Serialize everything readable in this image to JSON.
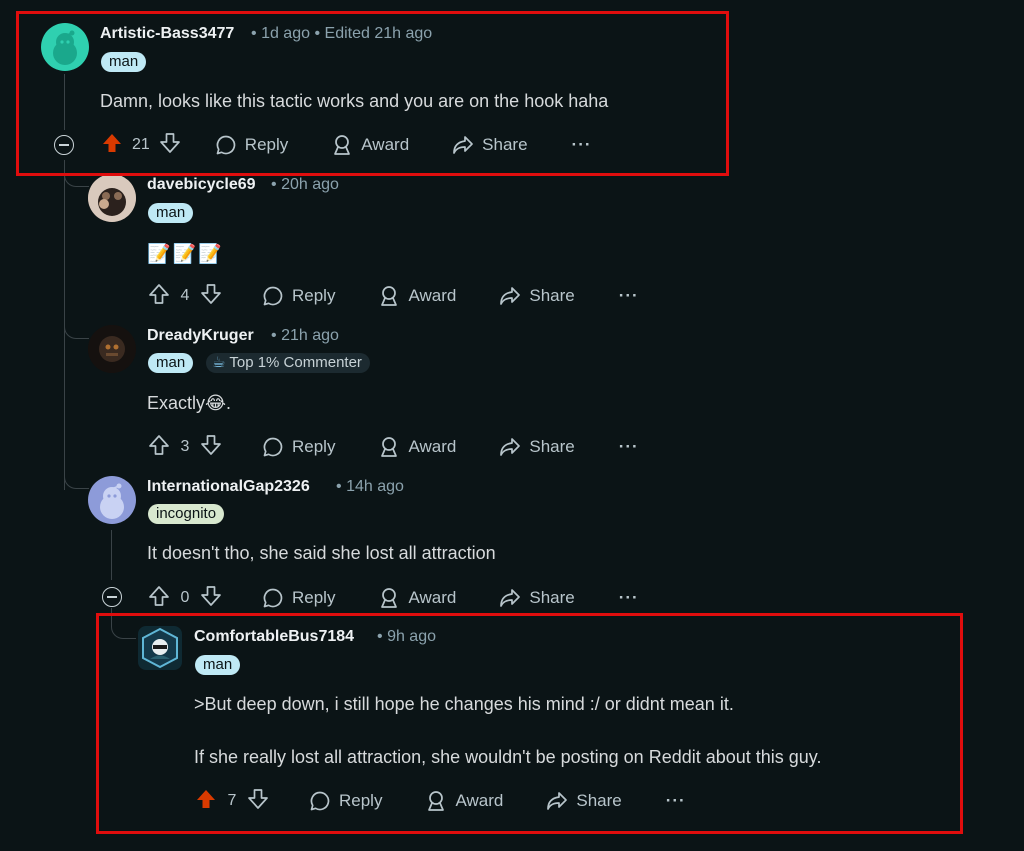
{
  "comments": [
    {
      "username": "Artistic-Bass3477",
      "time": "1d ago",
      "edited": "Edited 21h ago",
      "flair": "man",
      "body": "Damn, looks like this tactic works and you are on the hook haha",
      "votes": "21",
      "upvoted": true
    },
    {
      "username": "davebicycle69",
      "time": "20h ago",
      "flair": "man",
      "body": "📝📝📝",
      "votes": "4",
      "upvoted": false
    },
    {
      "username": "DreadyKruger",
      "time": "21h ago",
      "flair": "man",
      "badge": "Top 1% Commenter",
      "body": "Exactly😂.",
      "votes": "3",
      "upvoted": false
    },
    {
      "username": "InternationalGap2326",
      "time": "14h ago",
      "flair": "incognito",
      "body": "It doesn't tho, she said she lost all attraction",
      "votes": "0",
      "upvoted": false
    },
    {
      "username": "ComfortableBus7184",
      "time": "9h ago",
      "flair": "man",
      "body1": ">But deep down, i still hope he changes his mind :/ or didnt mean it.",
      "body2": "If she really lost all attraction, she wouldn't be posting on Reddit about this guy.",
      "votes": "7",
      "upvoted": true
    }
  ],
  "actions": {
    "reply": "Reply",
    "award": "Award",
    "share": "Share",
    "more": "···"
  },
  "separator": "•",
  "colors": {
    "background": "#0b1416",
    "upvote_active": "#d93a00",
    "highlight_border": "#e00d0d",
    "flair_man": "#bfe9f5",
    "flair_incognito": "#d8e8cf"
  }
}
